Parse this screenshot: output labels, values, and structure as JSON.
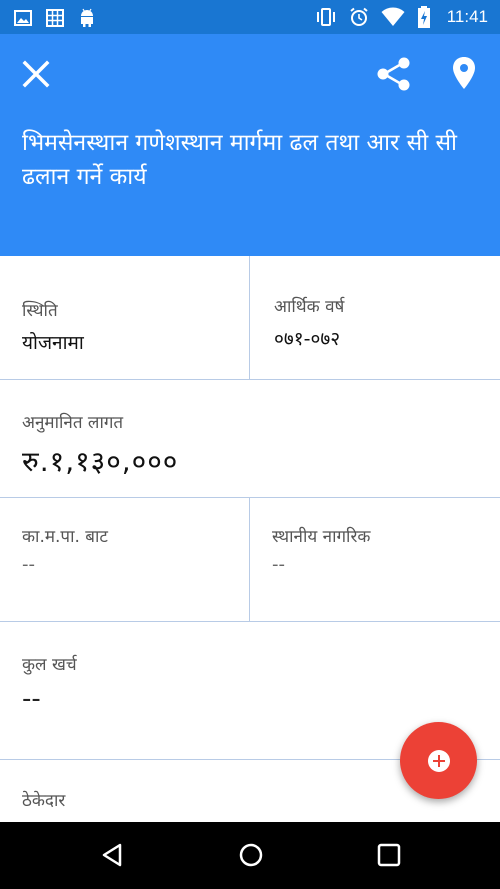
{
  "status_bar": {
    "time": "11:41",
    "left_icons": [
      "image-icon",
      "grid-icon",
      "android-icon"
    ],
    "right_icons": [
      "vibrate-icon",
      "alarm-icon",
      "wifi-icon",
      "battery-charging-icon"
    ]
  },
  "header": {
    "title": "भिमसेनस्थान गणेशस्थान मार्गमा ढल तथा आर सी सी ढलान गर्ने कार्य",
    "actions": [
      "close-icon",
      "share-icon",
      "location-pin-icon"
    ],
    "color": "#2f8af6"
  },
  "fields": {
    "status": {
      "label": "स्थिति",
      "value": "योजनामा"
    },
    "fiscal_year": {
      "label": "आर्थिक वर्ष",
      "value": "०७१-०७२"
    },
    "estimated_cost": {
      "label": "अनुमानित लागत",
      "value": "रु.१,१३०,०००"
    },
    "kmc_contribution": {
      "label": "का.म.पा. बाट",
      "value": "--"
    },
    "local_citizens": {
      "label": "स्थानीय नागरिक",
      "value": "--"
    },
    "total_expense": {
      "label": "कुल खर्च",
      "value": "--"
    },
    "contractor": {
      "label": "ठेकेदार",
      "value": ""
    }
  },
  "fab": {
    "icon": "add-icon",
    "color": "#ec4136"
  },
  "nav_bar": {
    "icons": [
      "back-icon",
      "home-icon",
      "recent-apps-icon"
    ]
  }
}
